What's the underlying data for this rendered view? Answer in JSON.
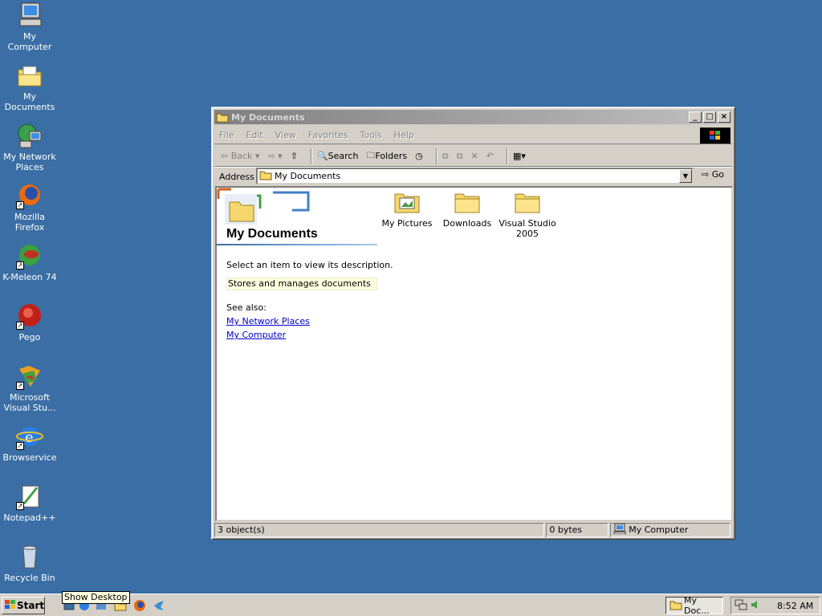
{
  "desktop": {
    "icons": [
      {
        "label": "My Computer",
        "icon": "computer-icon"
      },
      {
        "label": "My Documents",
        "icon": "documents-folder-icon"
      },
      {
        "label": "My Network Places",
        "icon": "network-places-icon"
      },
      {
        "label": "Mozilla Firefox",
        "icon": "firefox-icon"
      },
      {
        "label": "K-Meleon 74",
        "icon": "kmeleon-icon"
      },
      {
        "label": "Pego",
        "icon": "pego-icon"
      },
      {
        "label": "Microsoft Visual Stu...",
        "icon": "visual-studio-icon"
      },
      {
        "label": "Browservice",
        "icon": "browser-icon"
      },
      {
        "label": "Notepad++",
        "icon": "notepad-icon"
      },
      {
        "label": "Recycle Bin",
        "icon": "recycle-bin-icon"
      }
    ]
  },
  "window": {
    "title": "My Documents",
    "menu": [
      "File",
      "Edit",
      "View",
      "Favorites",
      "Tools",
      "Help"
    ],
    "toolbar": {
      "back": "Back",
      "search": "Search",
      "folders": "Folders"
    },
    "address": {
      "label": "Address",
      "value": "My Documents",
      "go": "Go"
    },
    "panel": {
      "title": "My Documents",
      "prompt": "Select an item to view its description.",
      "description": "Stores and manages documents",
      "see_also": "See also:",
      "links": [
        "My Network Places",
        "My Computer"
      ]
    },
    "items": [
      {
        "label": "My Pictures",
        "icon": "pictures-folder-icon"
      },
      {
        "label": "Downloads",
        "icon": "folder-icon"
      },
      {
        "label": "Visual Studio 2005",
        "icon": "folder-icon"
      }
    ],
    "status": {
      "objects": "3 object(s)",
      "size": "0 bytes",
      "zone": "My Computer"
    }
  },
  "taskbar": {
    "start": "Start",
    "tooltip": "Show Desktop",
    "task": "My Doc...",
    "clock": "8:52 AM"
  },
  "colors": {
    "desktop": "#3a6ea5",
    "face": "#d4d0c8",
    "link": "#0000cc",
    "highlight": "#ffffe1"
  }
}
